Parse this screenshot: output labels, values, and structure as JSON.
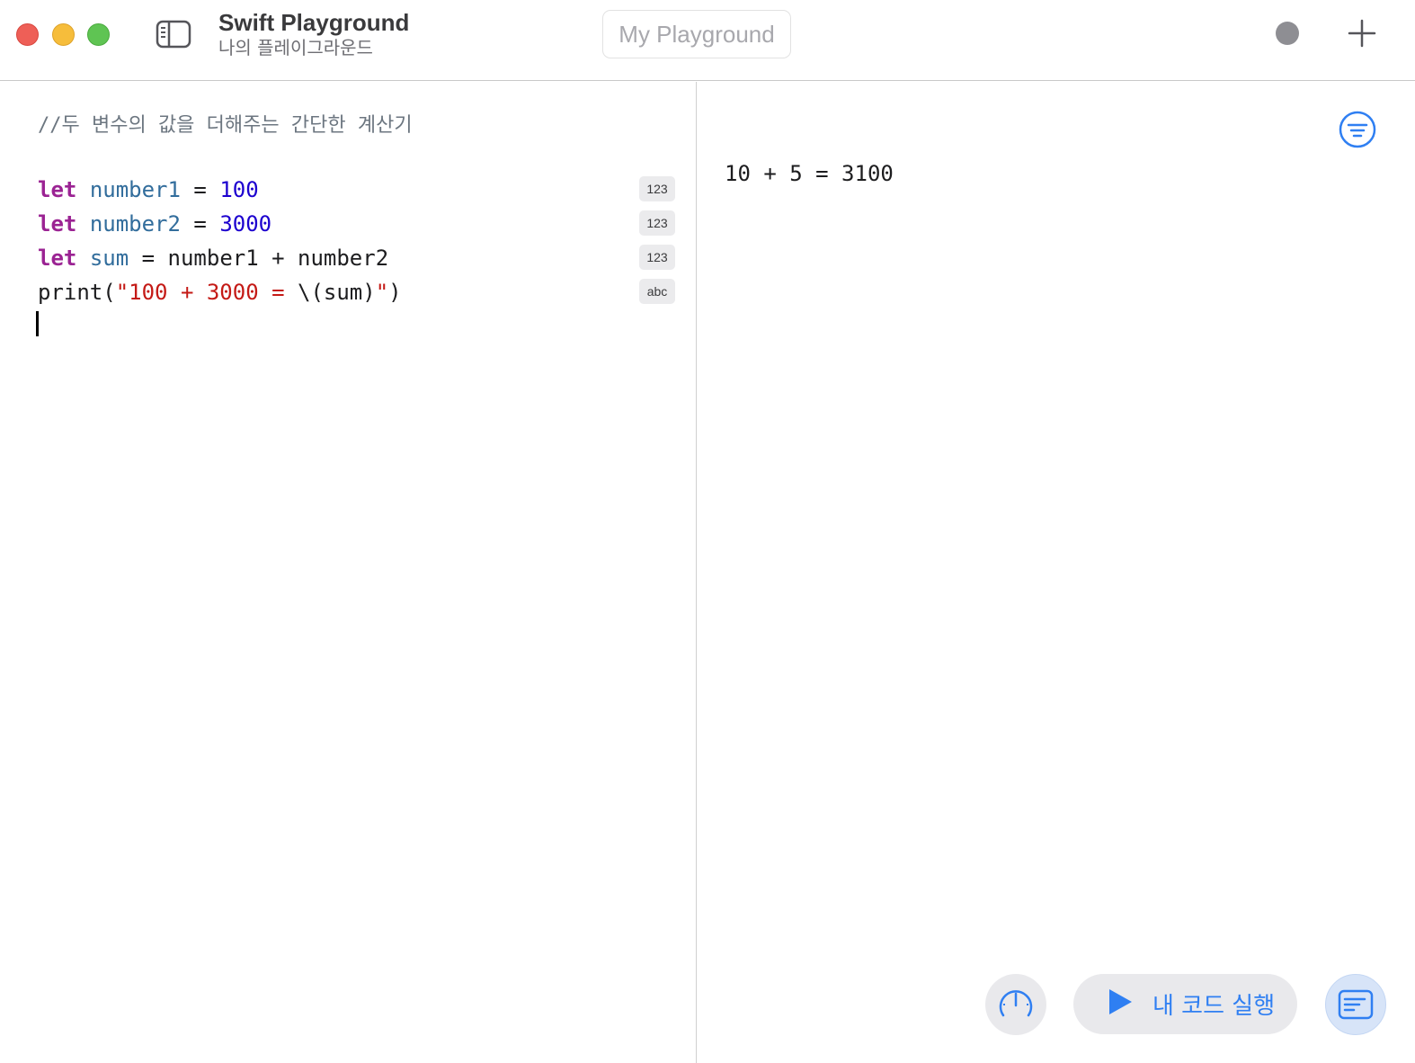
{
  "window": {
    "title": "Swift Playground",
    "subtitle": "나의 플레이그라운드",
    "name_field_placeholder": "My Playground"
  },
  "editor": {
    "comment": "//두 변수의 값을 더해주는 간단한 계산기",
    "lines": [
      {
        "tokens": [
          "let",
          " ",
          "number1",
          " = ",
          "100"
        ],
        "badge": "123"
      },
      {
        "tokens": [
          "let",
          " ",
          "number2",
          " = ",
          "3000"
        ],
        "badge": "123"
      },
      {
        "tokens": [
          "let",
          " ",
          "sum",
          " = number1 + number2"
        ],
        "badge": "123"
      },
      {
        "tokens": [
          "print(",
          "\"100 + 3000 = ",
          "\\(sum)",
          "\"",
          ")"
        ],
        "badge": "abc"
      }
    ]
  },
  "results": {
    "console_output": "10 + 5 = 3100"
  },
  "controls": {
    "run_label": "내 코드 실행"
  },
  "icons": {
    "sidebar_toggle": "sidebar-toggle-icon",
    "record": "record-dot-icon",
    "add": "plus-icon",
    "filter": "filter-icon",
    "speed": "speedometer-icon",
    "play": "play-icon",
    "console": "console-icon"
  },
  "colors": {
    "keyword": "#9b2393",
    "identifier": "#326d9c",
    "number": "#1c00cf",
    "string": "#c41a16",
    "accent": "#2f7ff2"
  }
}
